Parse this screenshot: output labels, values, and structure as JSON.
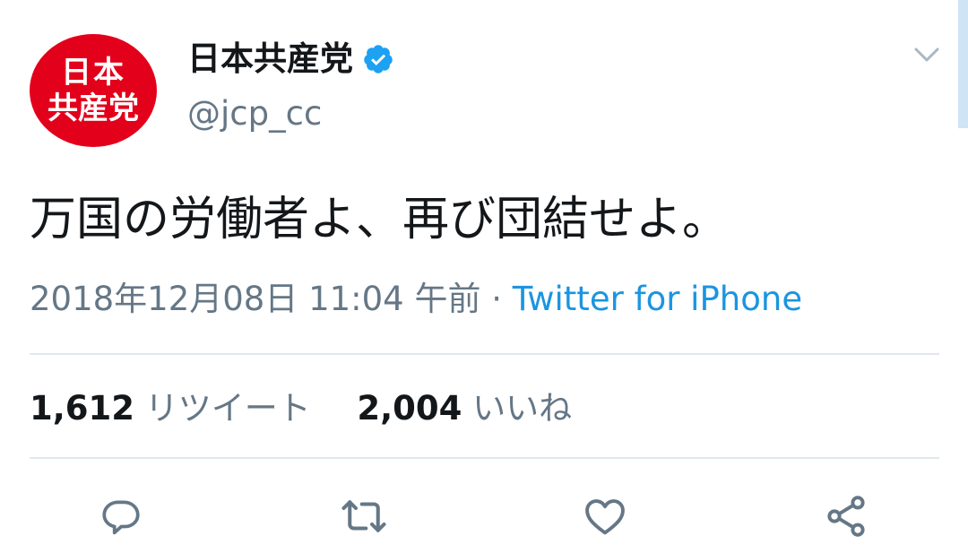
{
  "account": {
    "avatar_line1": "日本",
    "avatar_line2": "共産党",
    "display_name": "日本共産党",
    "handle": "@jcp_cc",
    "verified": true
  },
  "tweet": {
    "text": "万国の労働者よ、再び団結せよ。",
    "date": "2018年12月08日 11:04 午前",
    "separator": "·",
    "source": "Twitter for iPhone"
  },
  "stats": {
    "retweets_count": "1,612",
    "retweets_label": "リツイート",
    "likes_count": "2,004",
    "likes_label": "いいね"
  },
  "actions": {
    "icons": [
      "reply-icon",
      "retweet-icon",
      "like-icon",
      "share-icon"
    ]
  },
  "colors": {
    "avatar_bg": "#e3001b",
    "verified": "#1da1f2",
    "link": "#1b95e0",
    "secondary_text": "#657786",
    "icon": "#657786",
    "divider": "#e1e8ed"
  }
}
